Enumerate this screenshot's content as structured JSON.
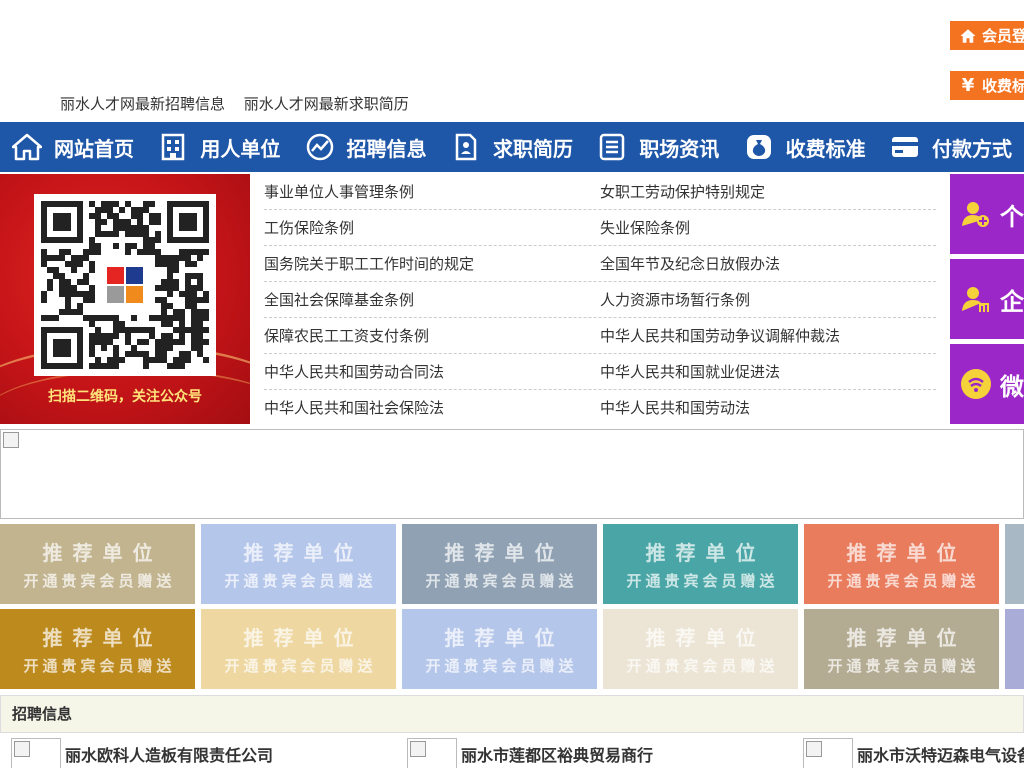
{
  "top_links": [
    "丽水人才网最新招聘信息",
    "丽水人才网最新求职简历"
  ],
  "side_buttons": {
    "login": "会员登",
    "fees": "收费标"
  },
  "nav": [
    {
      "label": "网站首页",
      "icon": "home-icon"
    },
    {
      "label": "用人单位",
      "icon": "building-icon"
    },
    {
      "label": "招聘信息",
      "icon": "chart-icon"
    },
    {
      "label": "求职简历",
      "icon": "resume-icon"
    },
    {
      "label": "职场资讯",
      "icon": "news-icon"
    },
    {
      "label": "收费标准",
      "icon": "money-bag-icon"
    },
    {
      "label": "付款方式",
      "icon": "card-icon"
    }
  ],
  "qr_caption": "扫描二维码，关注公众号",
  "regulations": [
    [
      "事业单位人事管理条例",
      "女职工劳动保护特别规定"
    ],
    [
      "工伤保险条例",
      "失业保险条例"
    ],
    [
      "国务院关于职工工作时间的规定",
      "全国年节及纪念日放假办法"
    ],
    [
      "全国社会保障基金条例",
      "人力资源市场暂行条例"
    ],
    [
      "保障农民工工资支付条例",
      "中华人民共和国劳动争议调解仲裁法"
    ],
    [
      "中华人民共和国劳动合同法",
      "中华人民共和国就业促进法"
    ],
    [
      "中华人民共和国社会保险法",
      "中华人民共和国劳动法"
    ]
  ],
  "purple_tiles": [
    {
      "label": "个",
      "icon": "person-add-icon"
    },
    {
      "label": "企",
      "icon": "enterprise-icon"
    },
    {
      "label": "微",
      "icon": "wechat-icon"
    }
  ],
  "recommend": {
    "line1": "推荐单位",
    "line2": "开通贵宾会员赠送",
    "row1_colors": [
      "#c2b48f",
      "#b5c6eb",
      "#8fa1b2",
      "#4aa6a6",
      "#e97c5d",
      "#a8b8c4"
    ],
    "row2_colors": [
      "#bd8a1e",
      "#eed7a1",
      "#b5c6eb",
      "#ece4d4",
      "#b4ab93",
      "#a9acd7"
    ]
  },
  "recruit_title": "招聘信息",
  "companies": [
    "丽水欧科人造板有限责任公司",
    "丽水市莲都区裕典贸易商行",
    "丽水市沃特迈森电气设备"
  ]
}
